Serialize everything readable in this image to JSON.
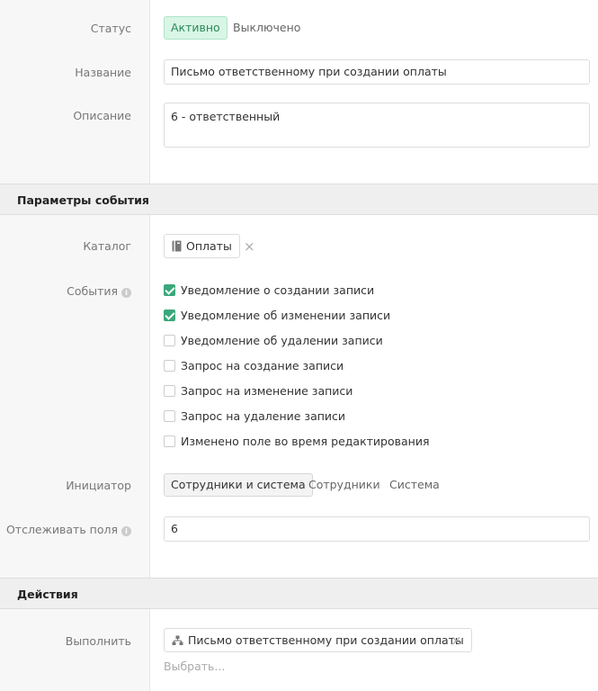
{
  "status": {
    "label": "Статус",
    "options": [
      "Активно",
      "Выключено"
    ],
    "selected": "Активно"
  },
  "name": {
    "label": "Название",
    "value": "Письмо ответственному при создании оплаты"
  },
  "description": {
    "label": "Описание",
    "value": "6 - ответственный"
  },
  "event_params": {
    "header": "Параметры события",
    "catalog": {
      "label": "Каталог",
      "value": "Оплаты",
      "icon": "book-icon"
    },
    "events": {
      "label": "События",
      "items": [
        {
          "label": "Уведомление о создании записи",
          "checked": true
        },
        {
          "label": "Уведомление об изменении записи",
          "checked": true
        },
        {
          "label": "Уведомление об удалении записи",
          "checked": false
        },
        {
          "label": "Запрос на создание записи",
          "checked": false
        },
        {
          "label": "Запрос на изменение записи",
          "checked": false
        },
        {
          "label": "Запрос на удаление записи",
          "checked": false
        },
        {
          "label": "Изменено поле во время редактирования",
          "checked": false
        }
      ]
    },
    "initiator": {
      "label": "Инициатор",
      "options": [
        "Сотрудники и система",
        "Сотрудники",
        "Система"
      ],
      "selected": "Сотрудники и система"
    },
    "track_fields": {
      "label": "Отслеживать поля",
      "value": "6"
    }
  },
  "actions": {
    "header": "Действия",
    "execute": {
      "label": "Выполнить",
      "value": "Письмо ответственному при создании оплаты",
      "icon": "hierarchy-icon",
      "choose_placeholder": "Выбрать..."
    }
  },
  "colors": {
    "accent_green": "#3aa87a",
    "active_tag_bg": "#d9f5e6",
    "section_bg": "#efefef",
    "label_color": "#777777"
  }
}
